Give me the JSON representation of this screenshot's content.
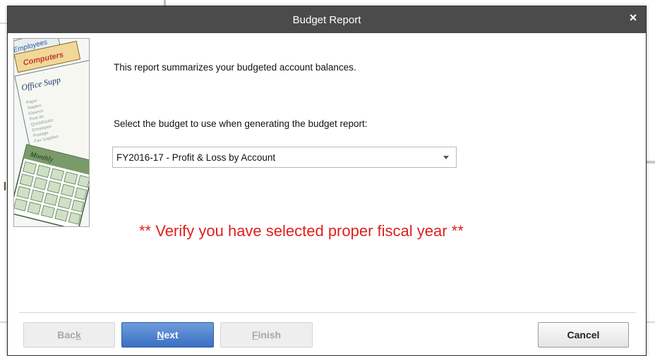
{
  "dialog": {
    "title": "Budget Report",
    "close_glyph": "×"
  },
  "illustration": {
    "tab_employees": "Employees",
    "tab_computers": "Computers",
    "card_title": "Office Supp",
    "calendar_label": "Monthly",
    "card_lines": [
      "Paper",
      "Staples",
      "Kleenex",
      "Post-its",
      "QuickBooks",
      "Envelopes",
      "Postage",
      "Fax Supplies"
    ]
  },
  "content": {
    "intro": "This report summarizes your budgeted account balances.",
    "select_prompt": "Select the budget to use when generating the budget report:",
    "budget_selected": "FY2016-17 - Profit & Loss by Account",
    "warning": "** Verify you have selected proper fiscal year **"
  },
  "buttons": {
    "back_pre": "Bac",
    "back_key": "k",
    "back_post": "",
    "next_pre": "",
    "next_key": "N",
    "next_post": "ext",
    "finish_pre": "",
    "finish_key": "F",
    "finish_post": "inish",
    "cancel": "Cancel"
  },
  "colors": {
    "titlebar": "#4b4b4b",
    "warning": "#e01f1f",
    "primary_button": "#3a6fc2"
  }
}
